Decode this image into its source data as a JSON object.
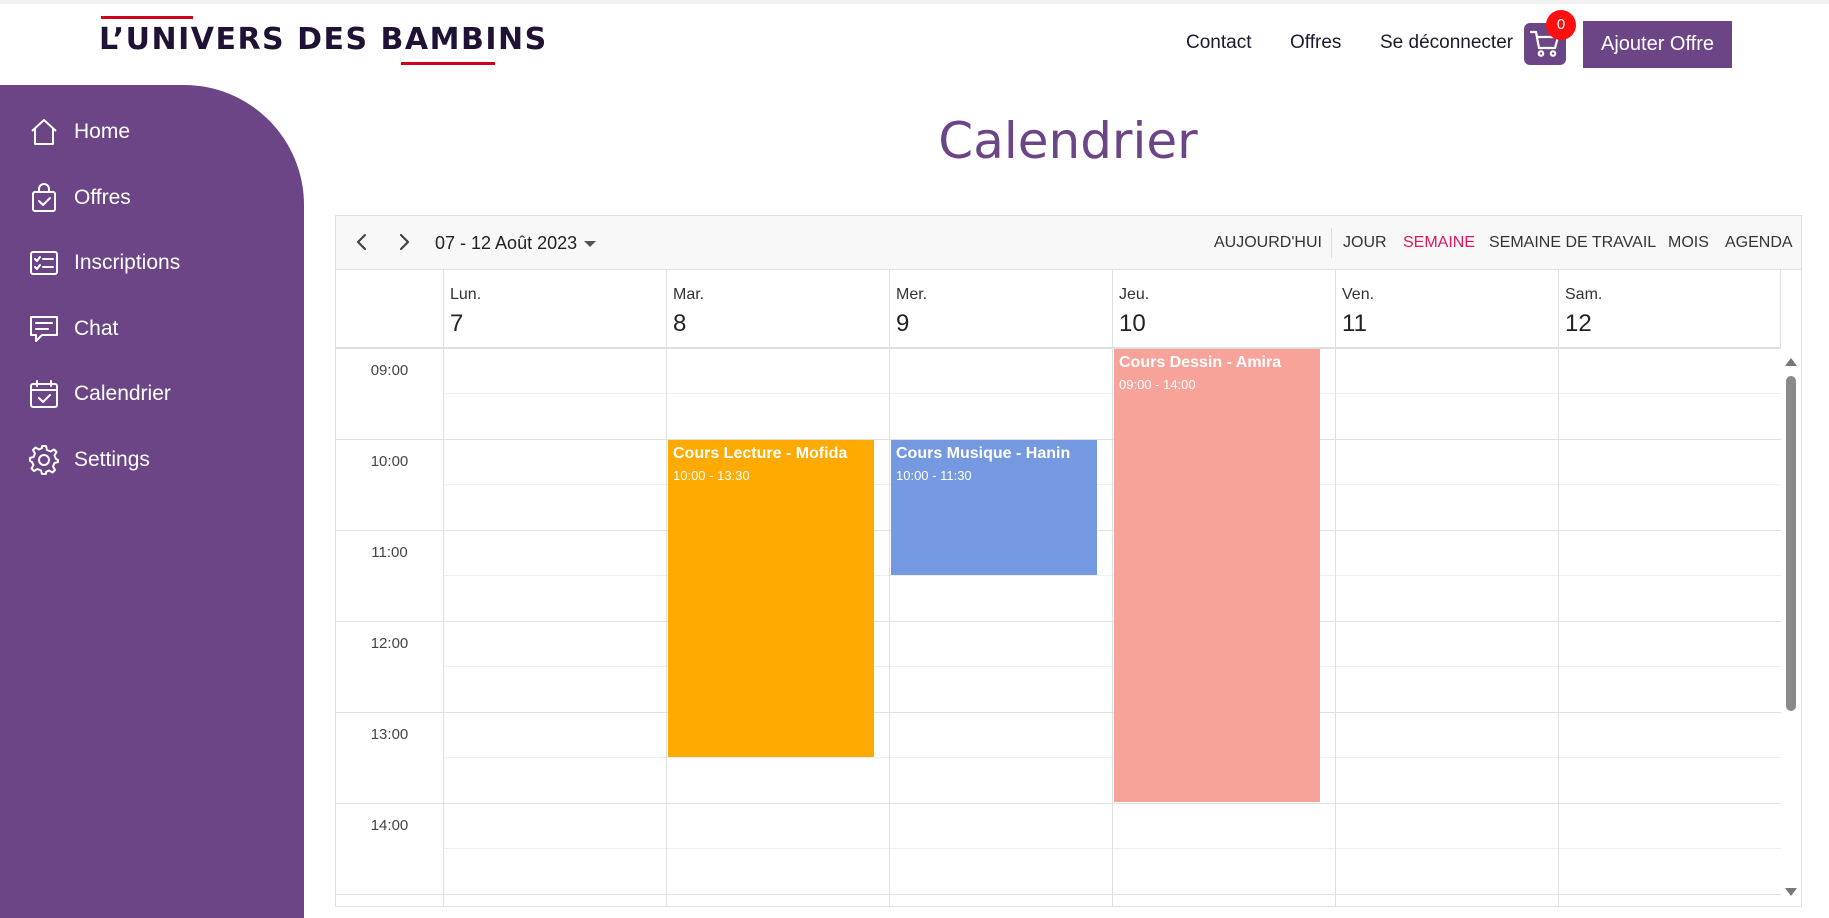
{
  "brand": {
    "logo_text": "L’UNIVERS DES BAMBINS",
    "accent": "#6c4586",
    "logo_red": "#d0021b"
  },
  "header": {
    "nav": [
      "Contact",
      "Offres",
      "Se déconnecter"
    ],
    "cart_icon": "cart-icon",
    "cart_count": "0",
    "add_button": "Ajouter Offre"
  },
  "sidebar": {
    "items": [
      {
        "label": "Home",
        "icon": "home-icon"
      },
      {
        "label": "Offres",
        "icon": "shopping-bag-icon"
      },
      {
        "label": "Inscriptions",
        "icon": "checklist-icon"
      },
      {
        "label": "Chat",
        "icon": "chat-icon"
      },
      {
        "label": "Calendrier",
        "icon": "calendar-icon"
      },
      {
        "label": "Settings",
        "icon": "gear-icon"
      }
    ]
  },
  "page": {
    "title": "Calendrier"
  },
  "scheduler": {
    "range": "07 - 12 Août 2023",
    "views": [
      "AUJOURD'HUI",
      "JOUR",
      "SEMAINE",
      "SEMAINE DE TRAVAIL",
      "MOIS",
      "AGENDA"
    ],
    "active_view": "SEMAINE",
    "days": [
      {
        "name": "Lun.",
        "num": "7"
      },
      {
        "name": "Mar.",
        "num": "8"
      },
      {
        "name": "Mer.",
        "num": "9"
      },
      {
        "name": "Jeu.",
        "num": "10"
      },
      {
        "name": "Ven.",
        "num": "11"
      },
      {
        "name": "Sam.",
        "num": "12"
      }
    ],
    "times": [
      "09:00",
      "10:00",
      "11:00",
      "12:00",
      "13:00",
      "14:00"
    ],
    "events": [
      {
        "title": "Cours Lecture - Mofida",
        "time": "10:00 - 13:30",
        "color": "#ffaa00"
      },
      {
        "title": "Cours Musique - Hanin",
        "time": "10:00 - 11:30",
        "color": "#7499e1"
      },
      {
        "title": "Cours Dessin - Amira",
        "time": "09:00 - 14:00",
        "color": "#f7a399"
      }
    ]
  }
}
